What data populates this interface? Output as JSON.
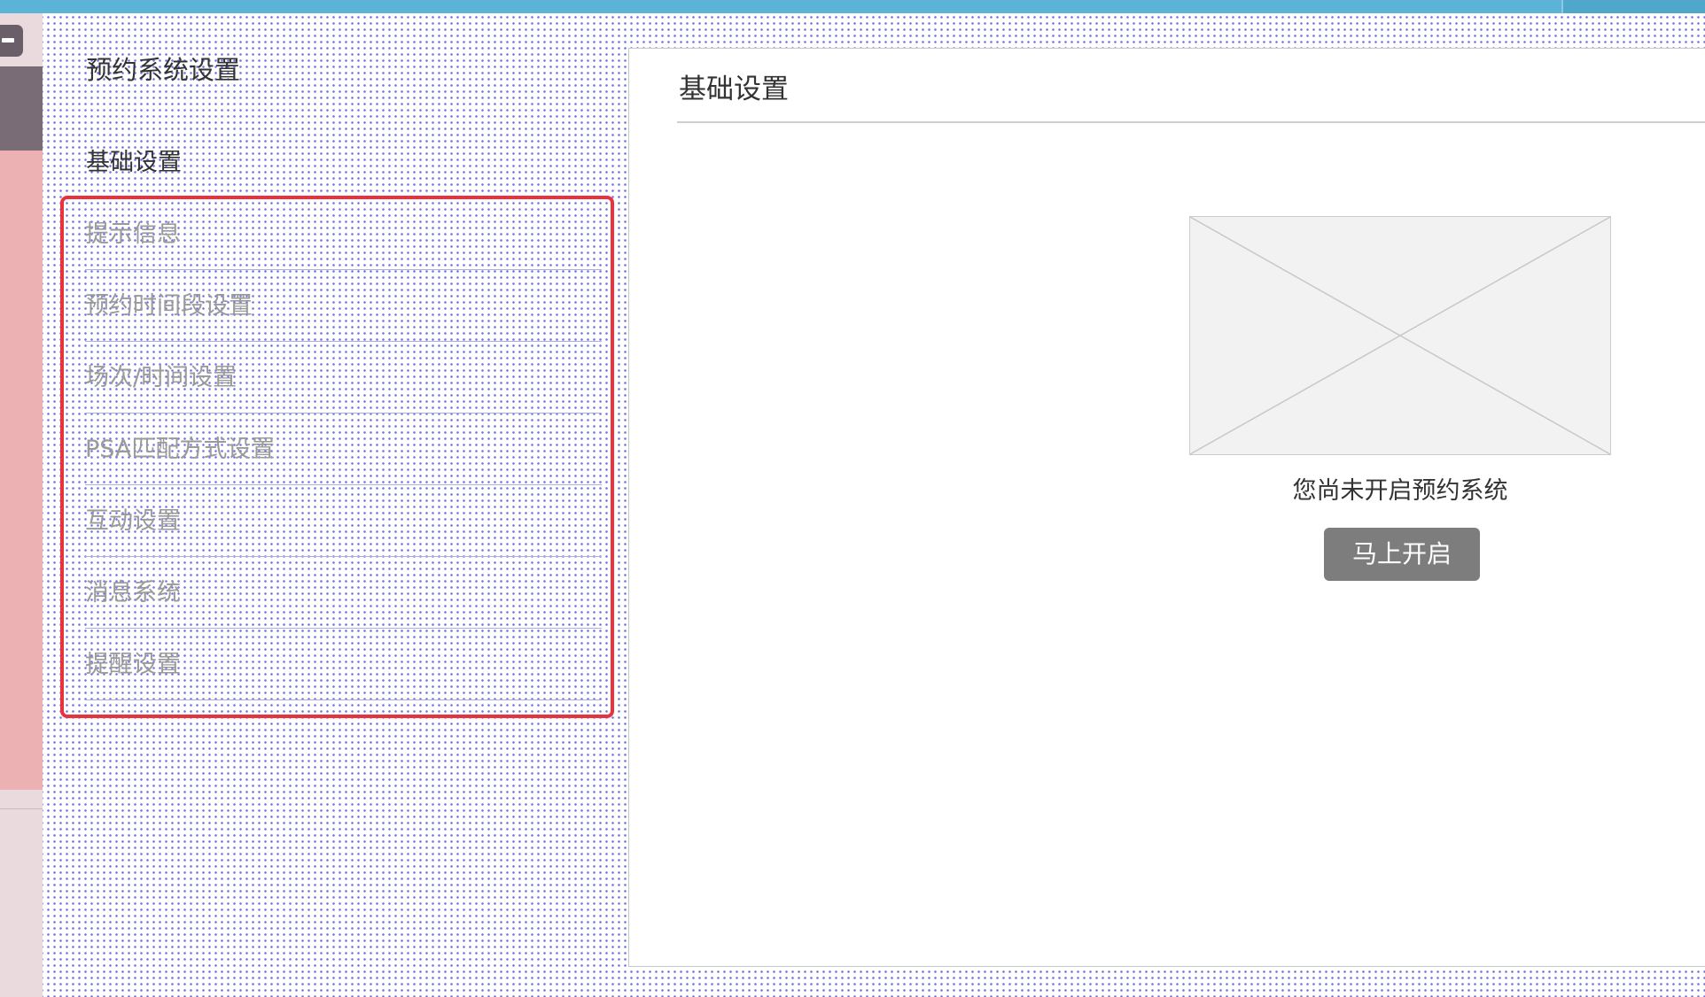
{
  "icons": {
    "collapse": "minus-icon",
    "placeholder": "image-placeholder-icon"
  },
  "colors": {
    "topbar": "#5bb4d8",
    "highlight_border": "#e8333c",
    "button": "#7d7d7d",
    "sidebar_pink": "#ebb1b3",
    "sidebar_dark": "#7a6c77"
  },
  "settings_nav": {
    "title": "预约系统设置",
    "section_label": "基础设置",
    "items": [
      {
        "label": "提示信息"
      },
      {
        "label": "预约时间段设置"
      },
      {
        "label": "场次/时间设置"
      },
      {
        "label": "PSA匹配方式设置"
      },
      {
        "label": "互动设置"
      },
      {
        "label": "消息系统"
      },
      {
        "label": "提醒设置"
      }
    ]
  },
  "main": {
    "header": "基础设置",
    "empty_message": "您尚未开启预约系统",
    "enable_button": "马上开启"
  }
}
